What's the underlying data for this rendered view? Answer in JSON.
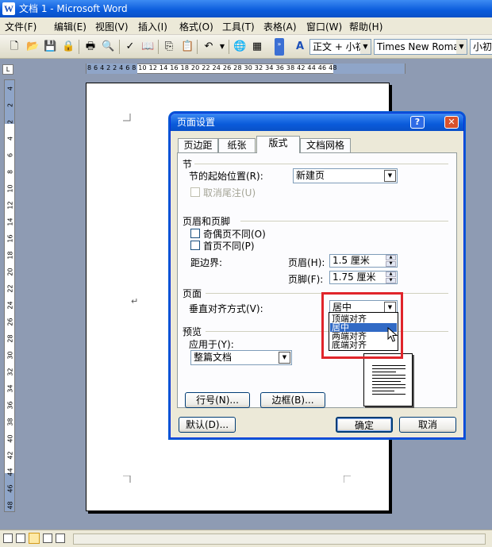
{
  "window": {
    "title": "文档 1 - Microsoft Word"
  },
  "menu": [
    "文件(F)",
    "编辑(E)",
    "视图(V)",
    "插入(I)",
    "格式(O)",
    "工具(T)",
    "表格(A)",
    "窗口(W)",
    "帮助(H)"
  ],
  "toolbar": {
    "style_value": "正文 + 小初",
    "font_value": "Times New Roman",
    "size_value": "小初"
  },
  "ruler": {
    "h_numbers": "8 6 4 2   2 4 6 8 10 12 14 16 18 20 22 24 26 28 30 32 34 36 38   42 44 46 48",
    "corner_tab": "L",
    "v_numbers": [
      "4",
      "2",
      "2",
      "4",
      "6",
      "8",
      "10",
      "12",
      "14",
      "16",
      "18",
      "20",
      "22",
      "24",
      "26",
      "28",
      "30",
      "32",
      "34",
      "36",
      "38",
      "40",
      "42",
      "44",
      "46",
      "48"
    ]
  },
  "document": {
    "paragraph_mark": "↵"
  },
  "dialog": {
    "title": "页面设置",
    "help_btn": "?",
    "close_btn": "✕",
    "tabs": [
      "页边距",
      "纸张",
      "版式",
      "文档网格"
    ],
    "active_tab": "版式",
    "section": {
      "heading": "节",
      "start_label": "节的起始位置(R):",
      "start_value": "新建页",
      "suppress_endnotes": "取消尾注(U)"
    },
    "header_footer": {
      "heading": "页眉和页脚",
      "odd_even": "奇偶页不同(O)",
      "first_page": "首页不同(P)",
      "from_edge": "距边界:",
      "header_label": "页眉(H):",
      "header_value": "1.5 厘米",
      "footer_label": "页脚(F):",
      "footer_value": "1.75 厘米"
    },
    "page": {
      "heading": "页面",
      "valign_label": "垂直对齐方式(V):",
      "valign_value": "居中",
      "valign_options": [
        "顶端对齐",
        "居中",
        "两端对齐",
        "底端对齐"
      ],
      "highlighted_option": "居中"
    },
    "preview": {
      "heading": "预览",
      "apply_label": "应用于(Y):",
      "apply_value": "整篇文档"
    },
    "buttons": {
      "line_numbers": "行号(N)...",
      "borders": "边框(B)...",
      "default": "默认(D)...",
      "ok": "确定",
      "cancel": "取消"
    }
  },
  "colors": {
    "titlebar": "#0a5bdb",
    "highlight_box": "#e0242a",
    "selection": "#316ac5"
  }
}
